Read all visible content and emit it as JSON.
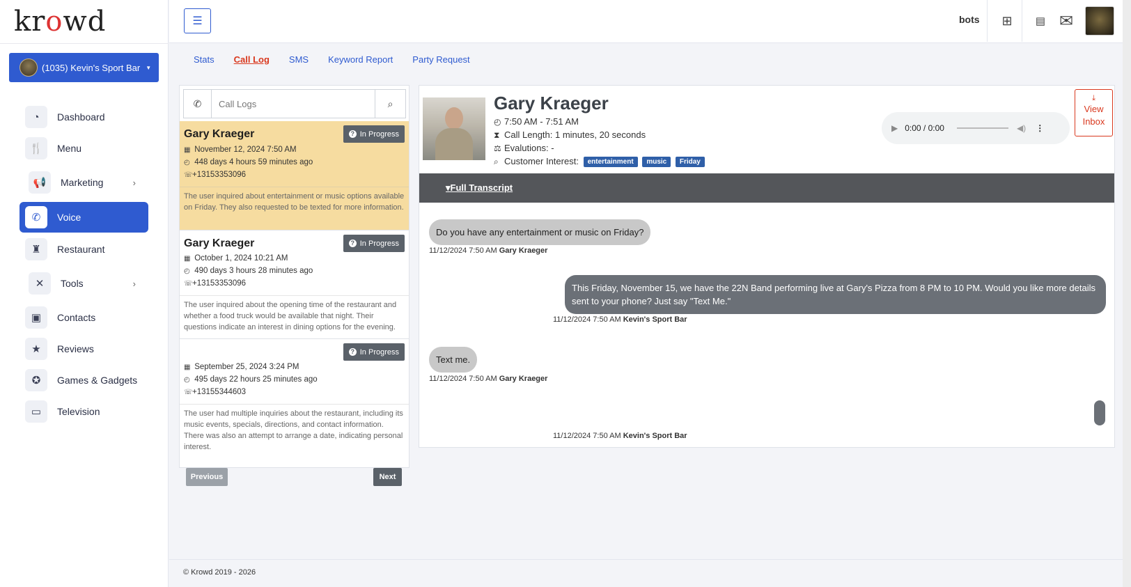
{
  "brand": {
    "logo_text_a": "kr",
    "logo_text_b": "wd"
  },
  "account": {
    "label": "(1035) Kevin's Sport Bar"
  },
  "sidebar": {
    "items": [
      {
        "label": "Dashboard",
        "icon": "speedometer-icon"
      },
      {
        "label": "Menu",
        "icon": "utensils-icon"
      },
      {
        "label": "Marketing",
        "icon": "megaphone-icon"
      },
      {
        "label": "Voice",
        "icon": "phone-voice-icon"
      },
      {
        "label": "Restaurant",
        "icon": "chef-icon"
      },
      {
        "label": "Tools",
        "icon": "tools-icon"
      },
      {
        "label": "Contacts",
        "icon": "contact-book-icon"
      },
      {
        "label": "Reviews",
        "icon": "star-icon"
      },
      {
        "label": "Games & Gadgets",
        "icon": "medal-icon"
      },
      {
        "label": "Television",
        "icon": "tv-icon"
      }
    ]
  },
  "topbar": {
    "bots_label": "bots"
  },
  "tabs": [
    "Stats",
    "Call Log",
    "SMS",
    "Keyword Report",
    "Party Request"
  ],
  "search": {
    "placeholder": "Call Logs"
  },
  "calls": [
    {
      "name": "Gary Kraeger",
      "status": "In Progress",
      "date": "November 12, 2024 7:50 AM",
      "ago": "448 days 4 hours 59 minutes ago",
      "phone": "+13153353096",
      "summary": "The user inquired about entertainment or music options available on Friday. They also requested to be texted for more information."
    },
    {
      "name": "Gary Kraeger",
      "status": "In Progress",
      "date": "October 1, 2024 10:21 AM",
      "ago": "490 days 3 hours 28 minutes ago",
      "phone": "+13153353096",
      "summary": "The user inquired about the opening time of the restaurant and whether a food truck would be available that night. Their questions indicate an interest in dining options for the evening."
    },
    {
      "name": "",
      "status": "In Progress",
      "date": "September 25, 2024 3:24 PM",
      "ago": "495 days 22 hours 25 minutes ago",
      "phone": "+13155344603",
      "summary": "The user had multiple inquiries about the restaurant, including its music events, specials, directions, and contact information. There was also an attempt to arrange a date, indicating personal interest."
    }
  ],
  "pagination": {
    "prev": "Previous",
    "next": "Next"
  },
  "detail": {
    "name": "Gary Kraeger",
    "time_range": "7:50 AM - 7:51 AM",
    "call_length": "Call Length: 1 minutes, 20 seconds",
    "evaluations": "Evalutions: -",
    "interest_label": "Customer Interest:",
    "tags": [
      "entertainment",
      "music",
      "Friday"
    ],
    "audio_time": "0:00 / 0:00",
    "view_inbox_1": "View",
    "view_inbox_2": "Inbox",
    "transcript_label": "Full Transcript"
  },
  "transcript": [
    {
      "text": "Do you have any entertainment or music on Friday?",
      "ts": "11/12/2024 7:50 AM",
      "who": "Gary Kraeger"
    },
    {
      "text": "This Friday, November 15, we have the 22N Band performing live at Gary's Pizza from 8 PM to 10 PM. Would you like more details sent to your phone? Just say \"Text Me.\"",
      "ts": "11/12/2024 7:50 AM",
      "who": "Kevin's Sport Bar"
    },
    {
      "text": "Text me.",
      "ts": "11/12/2024 7:50 AM",
      "who": "Gary Kraeger"
    },
    {
      "text": "",
      "ts": "11/12/2024 7:50 AM",
      "who": "Kevin's Sport Bar"
    }
  ],
  "footer": {
    "text": "© Krowd 2019 - 2026"
  },
  "colors": {
    "primary": "#2f5bd0",
    "selected_row": "#f6dca0",
    "accent_red": "#d9381e",
    "badge_gray": "#5a6169",
    "tag_blue": "#2f5fa8"
  }
}
